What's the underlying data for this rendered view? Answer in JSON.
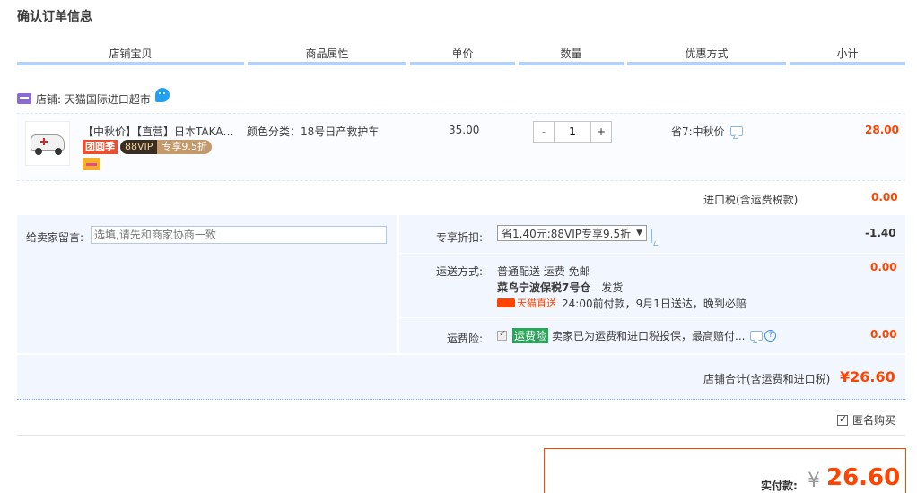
{
  "page_title": "确认订单信息",
  "columns": [
    "店铺宝贝",
    "商品属性",
    "单价",
    "数量",
    "优惠方式",
    "小计"
  ],
  "shop": {
    "label": "店铺: 天猫国际进口超市"
  },
  "item": {
    "name": "【中秋价】【直营】日本TAKARA TOMY多美卡合金车",
    "badge_tuan": "团圆季",
    "badge_vip_left": "88VIP",
    "badge_vip_right": "专享9.5折",
    "attr": "颜色分类：18号日产救护车",
    "price": "35.00",
    "qty": "1",
    "qty_minus": "-",
    "qty_plus": "+",
    "discount": "省7:中秋价",
    "subtotal": "28.00"
  },
  "tax": {
    "label": "进口税(含运费税款)",
    "value": "0.00"
  },
  "memo": {
    "label": "给卖家留言:",
    "placeholder": "选填,请先和商家协商一致"
  },
  "exclusive": {
    "label": "专享折扣:",
    "select": "省1.40元:88VIP专享9.5折",
    "value": "-1.40"
  },
  "shipping": {
    "label": "运送方式:",
    "method": "普通配送 运费 免邮",
    "warehouse": "菜鸟宁波保税7号仓",
    "warehouse_suffix": "发货",
    "tmall_tag": "天猫直送",
    "delivery": "24:00前付款，9月1日送达，晚到必赔",
    "value": "0.00"
  },
  "insurance": {
    "label": "运费险:",
    "badge": "运费险",
    "text": "卖家已为运费和进口税投保，最高赔付...",
    "value": "0.00"
  },
  "shop_total": {
    "label": "店铺合计(含运费和进口税)",
    "value": "¥26.60"
  },
  "anonymous": {
    "label": "匿名购买"
  },
  "pay": {
    "label": "实付款:",
    "yen": "¥",
    "value": "26.60"
  },
  "colors": {
    "accent": "#ff4400",
    "header_line": "#b2d1ff",
    "panel_bg": "#f2f7ff"
  }
}
